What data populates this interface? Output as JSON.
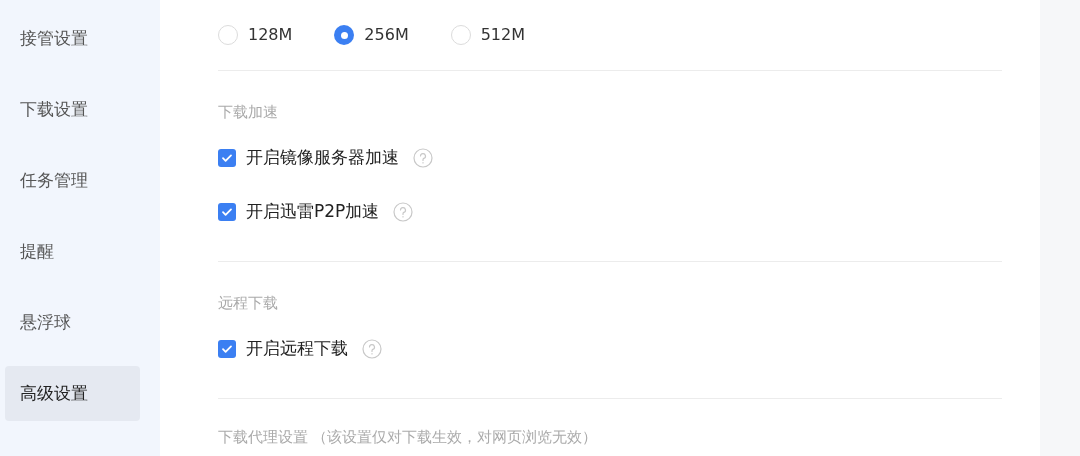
{
  "sidebar": {
    "items": [
      {
        "label": "接管设置",
        "selected": false
      },
      {
        "label": "下载设置",
        "selected": false
      },
      {
        "label": "任务管理",
        "selected": false
      },
      {
        "label": "提醒",
        "selected": false
      },
      {
        "label": "悬浮球",
        "selected": false
      },
      {
        "label": "高级设置",
        "selected": true
      }
    ]
  },
  "sections": [
    {
      "kind": "radio",
      "options": [
        {
          "label": "128M",
          "selected": false
        },
        {
          "label": "256M",
          "selected": true
        },
        {
          "label": "512M",
          "selected": false
        }
      ]
    },
    {
      "kind": "checkbox",
      "title": "下载加速",
      "options": [
        {
          "label": "开启镜像服务器加速",
          "checked": true
        },
        {
          "label": "开启迅雷P2P加速",
          "checked": true
        }
      ]
    },
    {
      "kind": "checkbox",
      "title": "远程下载",
      "options": [
        {
          "label": "开启远程下载",
          "checked": true
        }
      ]
    },
    {
      "kind": "heading",
      "title": "下载代理设置",
      "note": "（该设置仅对下载生效，对网页浏览无效）"
    }
  ]
}
